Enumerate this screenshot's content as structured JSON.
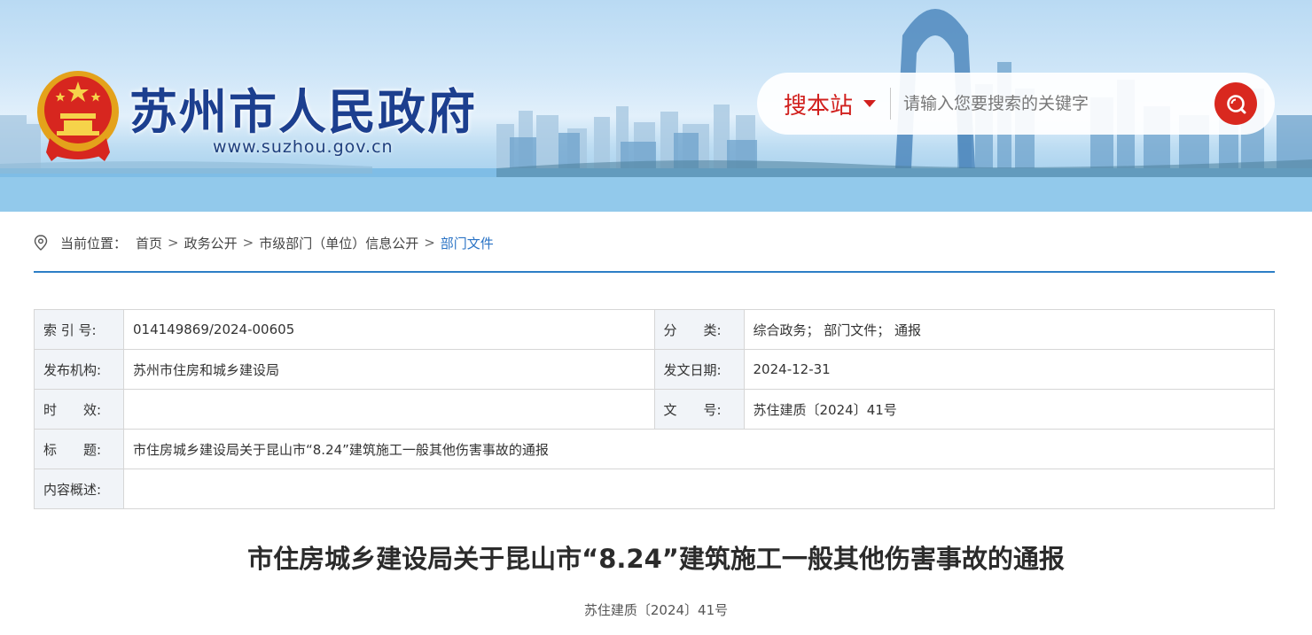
{
  "header": {
    "site_title": "苏州市人民政府",
    "site_url": "www.suzhou.gov.cn",
    "search": {
      "scope_label": "搜本站",
      "placeholder": "请输入您要搜索的关键字",
      "button_color": "#d9281f"
    },
    "emblem_icon": "national-emblem-icon"
  },
  "breadcrumb": {
    "prefix": "当前位置：",
    "items": [
      "首页",
      "政务公开",
      "市级部门（单位）信息公开",
      "部门文件"
    ],
    "separator": ">",
    "active_color": "#2a73c5"
  },
  "meta": {
    "index_label": "索 引 号:",
    "index_value": "014149869/2024-00605",
    "category_label": "分　　类:",
    "category_value": "综合政务； 部门文件； 通报",
    "publisher_label": "发布机构:",
    "publisher_value": "苏州市住房和城乡建设局",
    "date_label": "发文日期:",
    "date_value": "2024-12-31",
    "validity_label": "时　　效:",
    "validity_value": "",
    "docno_label": "文　　号:",
    "docno_value": "苏住建质〔2024〕41号",
    "title_label": "标　　题:",
    "title_value": "市住房城乡建设局关于昆山市“8.24”建筑施工一般其他伤害事故的通报",
    "summary_label": "内容概述:",
    "summary_value": ""
  },
  "article": {
    "title": "市住房城乡建设局关于昆山市“8.24”建筑施工一般其他伤害事故的通报",
    "doc_number": "苏住建质〔2024〕41号"
  }
}
